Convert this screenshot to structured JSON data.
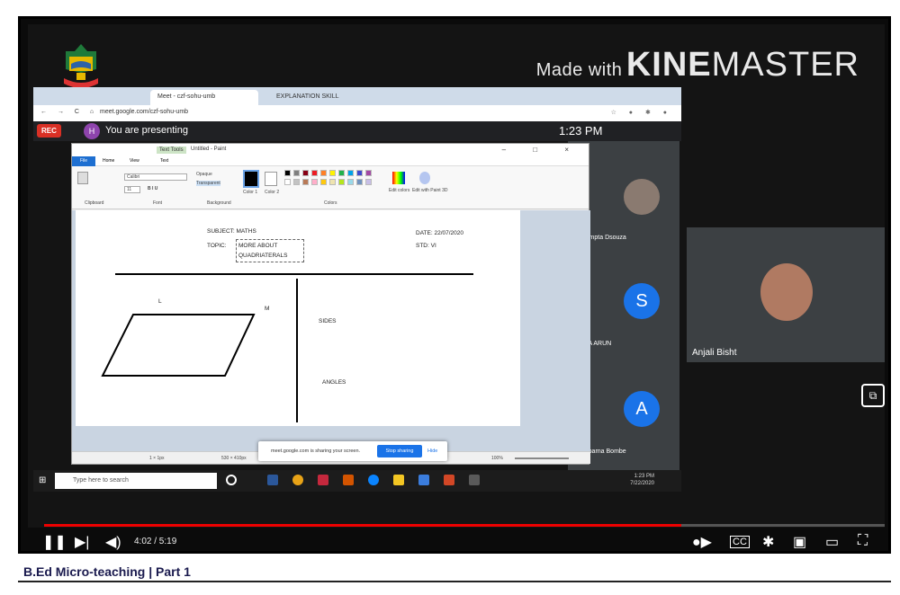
{
  "watermark": {
    "made": "Made with",
    "kine": "KINE",
    "master": "MASTER"
  },
  "browser": {
    "tabs": [
      "Meet - czf-sohu-umb",
      "EXPLANATION SKILL"
    ],
    "url": "meet.google.com/czf-sohu-umb"
  },
  "meet": {
    "rec": "REC",
    "avatar": "H",
    "presenting": "You are presenting",
    "time": "1:23 PM"
  },
  "paint": {
    "tab_tools": "Text Tools",
    "title": "Untitled - Paint",
    "tabs": [
      "File",
      "Home",
      "View",
      "Text"
    ],
    "font_name": "Calibri",
    "font_size": "11",
    "groups": [
      "Clipboard",
      "Font",
      "Background",
      "Colors"
    ],
    "bg_options": [
      "Opaque",
      "Transparent"
    ],
    "color_labels": [
      "Color 1",
      "Color 2",
      "Edit colors",
      "Edit with Paint 3D"
    ],
    "status_left": "1 × 1px",
    "status_size": "530 × 410px",
    "zoom": "100%"
  },
  "canvas": {
    "subject": "SUBJECT: MATHS",
    "topic_label": "TOPIC:",
    "topic_line1": "MORE ABOUT",
    "topic_line2": "QUADRIATERALS",
    "date": "DATE: 22/07/2020",
    "std": "STD: VI",
    "vertex_l": "L",
    "vertex_m": "M",
    "sides": "SIDES",
    "angles": "ANGLES"
  },
  "share": {
    "message": "meet.google.com is sharing your screen.",
    "stop": "Stop sharing",
    "hide": "Hide"
  },
  "taskbar": {
    "search_placeholder": "Type here to search",
    "time": "1:23 PM",
    "date": "7/22/2020"
  },
  "participants": [
    {
      "name": "Assumpta Dsouza",
      "initial": ""
    },
    {
      "name": "HIJA ARUN",
      "initial": "S"
    },
    {
      "name": "Aparna Bombe",
      "initial": "A"
    }
  ],
  "tile": {
    "name": "Anjali Bisht"
  },
  "player": {
    "time": "4:02 / 5:19",
    "progress": 0.758
  },
  "caption": "B.Ed Micro-teaching | Part 1"
}
